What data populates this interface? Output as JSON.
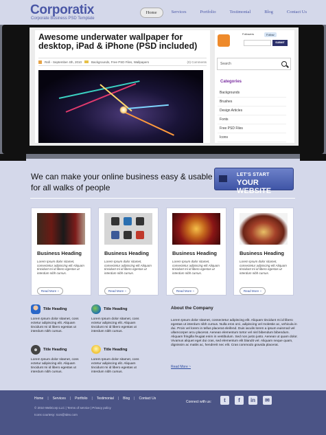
{
  "header": {
    "logo": "Corporatix",
    "tagline": "Corporate Business PSD Template",
    "nav": [
      "Home",
      "Services",
      "Portfolio",
      "Testimonial",
      "Blog",
      "Contact Us"
    ],
    "active_nav": "Home"
  },
  "post": {
    "title": "Awesome underwater wallpaper for desktop, iPad & iPhone (PSD included)",
    "author_date": "Rafi - September 4th, 2010",
    "categories": "Backgrounds, Free PSD Files, Wallpapers",
    "comments": "(0) Comments"
  },
  "sidebar": {
    "follow_label": "Followers",
    "follow_button": "Follow",
    "submit_label": "SUBMIT",
    "search_label": "Search",
    "categories_title": "Categories",
    "categories": [
      "Backgrounds",
      "Brushes",
      "Design Articles",
      "Fonts",
      "Free PSD Files",
      "Icons"
    ]
  },
  "intro": {
    "text": "We can make your online business easy & usable for all walks of people",
    "cta_line1": "LET'S START",
    "cta_line2": "YOUR WEBSITE"
  },
  "cards": [
    {
      "heading": "Business Heading",
      "text": "Lorem Ipsum dolor sitamet, consectetur adipiscing elit Aliquam tincidunt mi id libero egestas ut interdum nibh cursus.",
      "more": "Read More ~",
      "image": "wine-bottles-image"
    },
    {
      "heading": "Business Heading",
      "text": "Lorem Ipsum dolor sitamet, consectetur adipiscing elit Aliquam tincidunt mi id libero egestas ut interdum nibh cursus.",
      "more": "Read More ~",
      "image": "social-icons-image"
    },
    {
      "heading": "Business Heading",
      "text": "Lorem Ipsum dolor sitamet, consectetur adipiscing elit Aliquam tincidunt mi id libero egestas ut interdum nibh cursus.",
      "more": "Read More ~",
      "image": "film-reel-image"
    },
    {
      "heading": "Business Heading",
      "text": "Lorem Ipsum dolor sitamet, consectetur adipiscing elit Aliquam tincidunt mi id libero egestas ut interdum nibh cursus.",
      "more": "Read More ~",
      "image": "treasure-chest-image"
    }
  ],
  "features": [
    {
      "title": "Title Heading",
      "text": "Lorem Ipsum dolor sitamet, cons ectetur adipiscing elit. Aliquam tincidunt mi id libero egestas ut interdum nibh cursus.",
      "icon": "user-icon"
    },
    {
      "title": "Title Heading",
      "text": "Lorem Ipsum dolor sitamet, cons ectetur adipiscing elit. Aliquam tincidunt mi id libero egestas ut interdum nibh cursus.",
      "icon": "globe-icon"
    },
    {
      "title": "Title Heading",
      "text": "Lorem Ipsum dolor sitamet, cons ectetur adipiscing elit. Aliquam tincidunt mi id libero egestas ut interdum nibh cursus.",
      "icon": "film-icon"
    },
    {
      "title": "Title Heading",
      "text": "Lorem Ipsum dolor sitamet, cons ectetur adipiscing elit. Aliquam tincidunt mi id libero egestas ut interdum nibh cursus.",
      "icon": "lightbulb-icon"
    }
  ],
  "about": {
    "heading": "About the Company",
    "text": "Lorem Ipsum dolor sitamet, consectetur adipiscing elit. Aliquam tincidunt mi id libero egestas ut interdum nibh cursus. Nulla eros orci, adipiscing vel molestie ac, vehicula in dui. Proin vel lorem in tellus placerat eleifend. Duis iaculis lorem a ipsum euismod vel ullamcorper arcu placerat. Aenean elementum tortor vel nisl bibendum bibendum. Aliquam fringilla feugiat enim in vestibulum. Sed non justo justo. Aenean ut quam dolor. Vivamus aliquet eget dui cras, sed elementum elit blandit vel. Aliquam neque quam, dignissim ac mattis ac, hendrerit nec elit. Cras commodo gravida placerat.",
    "more": "Read More ~"
  },
  "footer": {
    "nav": [
      "Home",
      "Services",
      "Portfolio",
      "Testimonial",
      "Blog",
      "Contact Us"
    ],
    "copyright": "© 2010 WebCorp LLC  |  Terms of service  |  Privacy policy",
    "credits": "Icons courtesy: Icon@Idex.com",
    "connect": "Connect with us:"
  },
  "colors": {
    "brand": "#4a57a6",
    "footer": "#4b5486",
    "background": "#d4d8ea"
  }
}
